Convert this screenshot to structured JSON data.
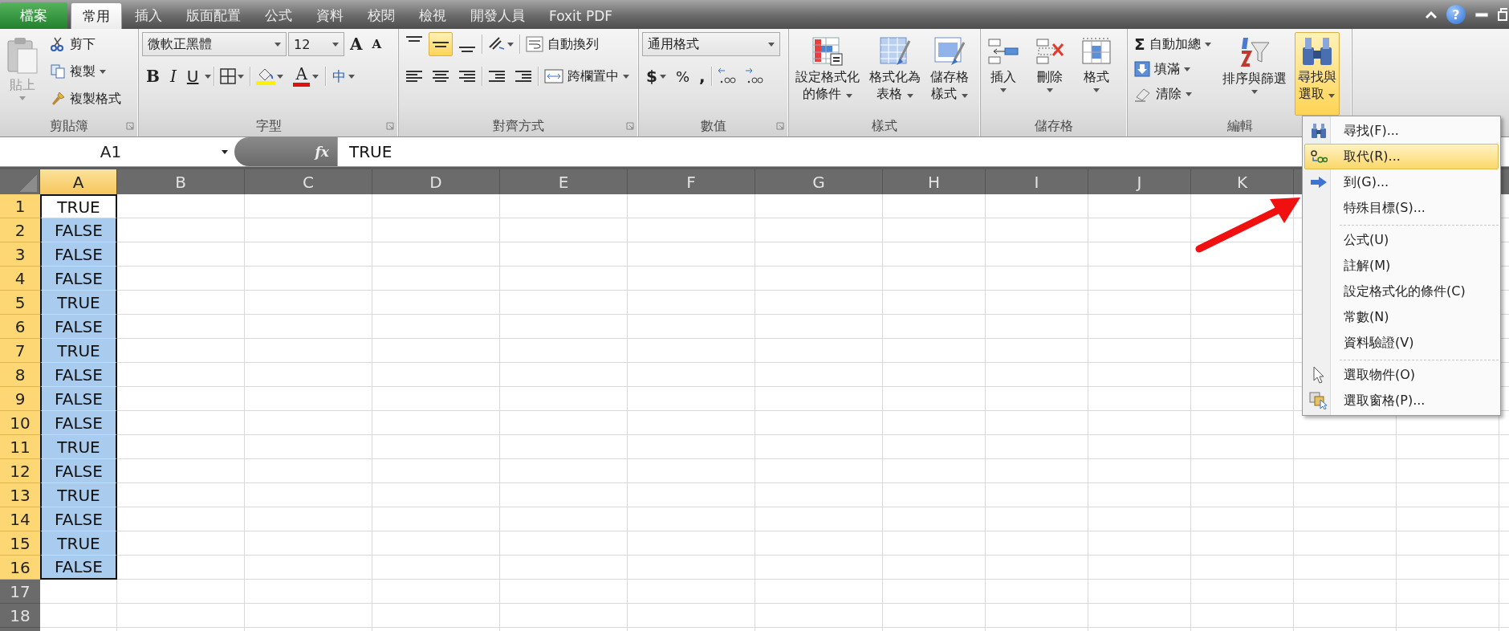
{
  "tabs": [
    {
      "label": "檔案",
      "kind": "file",
      "selected": false
    },
    {
      "label": "常用",
      "kind": "tab",
      "selected": true
    },
    {
      "label": "插入",
      "kind": "tab",
      "selected": false
    },
    {
      "label": "版面配置",
      "kind": "tab",
      "selected": false
    },
    {
      "label": "公式",
      "kind": "tab",
      "selected": false
    },
    {
      "label": "資料",
      "kind": "tab",
      "selected": false
    },
    {
      "label": "校閱",
      "kind": "tab",
      "selected": false
    },
    {
      "label": "檢視",
      "kind": "tab",
      "selected": false
    },
    {
      "label": "開發人員",
      "kind": "tab",
      "selected": false
    },
    {
      "label": "Foxit PDF",
      "kind": "tab",
      "selected": false
    }
  ],
  "window_controls": {
    "help": "?"
  },
  "ribbon": {
    "clipboard": {
      "title": "剪貼簿",
      "paste": {
        "label": "貼上",
        "disabled": true
      },
      "items": [
        {
          "label": "剪下",
          "dropdown": false
        },
        {
          "label": "複製",
          "dropdown": true
        },
        {
          "label": "複製格式",
          "dropdown": false
        }
      ]
    },
    "font": {
      "title": "字型",
      "font_name": "微軟正黑體",
      "font_size": "12",
      "grow": "A",
      "shrink": "A",
      "bold": "B",
      "italic": "I",
      "underline": "U",
      "font_color": "A",
      "phonetic": "中"
    },
    "alignment": {
      "title": "對齊方式",
      "vertical": [
        {
          "selected": false
        },
        {
          "selected": true
        },
        {
          "selected": false
        }
      ],
      "wrap_text": "自動換列",
      "merge_center": "跨欄置中"
    },
    "number": {
      "title": "數值",
      "format": "通用格式",
      "currency": "$",
      "percent": "%",
      "comma": ","
    },
    "styles": {
      "title": "樣式",
      "buttons": [
        {
          "label": [
            "設定格式化",
            "的條件"
          ]
        },
        {
          "label": [
            "格式化為",
            "表格"
          ]
        },
        {
          "label": [
            "儲存格",
            "樣式"
          ]
        }
      ]
    },
    "cells": {
      "title": "儲存格",
      "buttons": [
        {
          "label": "插入"
        },
        {
          "label": "刪除"
        },
        {
          "label": "格式"
        }
      ]
    },
    "editing": {
      "title": "編輯",
      "items": [
        {
          "symbol": "Σ",
          "label": "自動加總"
        },
        {
          "label": "填滿"
        },
        {
          "label": "清除"
        }
      ],
      "sort_filter": "排序與篩選",
      "find_select": {
        "label": [
          "尋找與",
          "選取"
        ],
        "selected": true
      }
    }
  },
  "formula_bar": {
    "name_box": "A1",
    "fx": "fx",
    "formula": "TRUE"
  },
  "sheet": {
    "columns": [
      {
        "label": "A",
        "selected": true
      },
      {
        "label": "B",
        "selected": false
      },
      {
        "label": "C",
        "selected": false
      },
      {
        "label": "D",
        "selected": false
      },
      {
        "label": "E",
        "selected": false
      },
      {
        "label": "F",
        "selected": false
      },
      {
        "label": "G",
        "selected": false
      },
      {
        "label": "H",
        "selected": false
      },
      {
        "label": "I",
        "selected": false
      },
      {
        "label": "J",
        "selected": false
      },
      {
        "label": "K",
        "selected": false
      }
    ],
    "rows": [
      {
        "number": "1",
        "selected": true,
        "active": true,
        "value": "TRUE"
      },
      {
        "number": "2",
        "selected": true,
        "active": false,
        "value": "FALSE"
      },
      {
        "number": "3",
        "selected": true,
        "active": false,
        "value": "FALSE"
      },
      {
        "number": "4",
        "selected": true,
        "active": false,
        "value": "FALSE"
      },
      {
        "number": "5",
        "selected": true,
        "active": false,
        "value": "TRUE"
      },
      {
        "number": "6",
        "selected": true,
        "active": false,
        "value": "FALSE"
      },
      {
        "number": "7",
        "selected": true,
        "active": false,
        "value": "TRUE"
      },
      {
        "number": "8",
        "selected": true,
        "active": false,
        "value": "FALSE"
      },
      {
        "number": "9",
        "selected": true,
        "active": false,
        "value": "FALSE"
      },
      {
        "number": "10",
        "selected": true,
        "active": false,
        "value": "FALSE"
      },
      {
        "number": "11",
        "selected": true,
        "active": false,
        "value": "TRUE"
      },
      {
        "number": "12",
        "selected": true,
        "active": false,
        "value": "FALSE"
      },
      {
        "number": "13",
        "selected": true,
        "active": false,
        "value": "TRUE"
      },
      {
        "number": "14",
        "selected": true,
        "active": false,
        "value": "FALSE"
      },
      {
        "number": "15",
        "selected": true,
        "active": false,
        "value": "TRUE"
      },
      {
        "number": "16",
        "selected": true,
        "active": false,
        "value": "FALSE"
      },
      {
        "number": "17",
        "selected": false,
        "active": false
      },
      {
        "number": "18",
        "selected": false,
        "active": false
      }
    ]
  },
  "menu": {
    "items": [
      {
        "kind": "item",
        "label": "尋找(F)...",
        "selected": false
      },
      {
        "kind": "item",
        "label": "取代(R)...",
        "selected": true
      },
      {
        "kind": "item",
        "label": "到(G)...",
        "selected": false
      },
      {
        "kind": "item",
        "label": "特殊目標(S)...",
        "selected": false
      },
      {
        "kind": "separator"
      },
      {
        "kind": "item",
        "label": "公式(U)",
        "selected": false
      },
      {
        "kind": "item",
        "label": "註解(M)",
        "selected": false
      },
      {
        "kind": "item",
        "label": "設定格式化的條件(C)",
        "selected": false
      },
      {
        "kind": "item",
        "label": "常數(N)",
        "selected": false
      },
      {
        "kind": "item",
        "label": "資料驗證(V)",
        "selected": false
      },
      {
        "kind": "separator"
      },
      {
        "kind": "item",
        "label": "選取物件(O)",
        "selected": false
      },
      {
        "kind": "item",
        "label": "選取窗格(P)...",
        "selected": false
      }
    ]
  },
  "annotation": {
    "kind": "arrow"
  }
}
